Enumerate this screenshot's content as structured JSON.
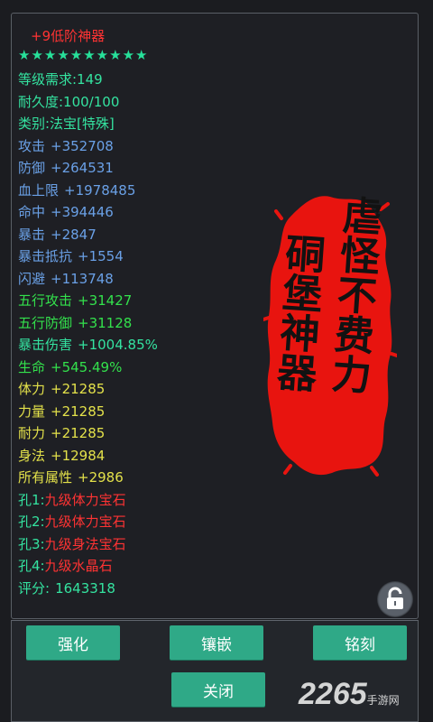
{
  "item": {
    "name": "+9低阶神器",
    "stars": "★★★★★★★★★★",
    "stats": [
      {
        "label": "等级需求:149",
        "value": "",
        "color": "green"
      },
      {
        "label": "耐久度:100/100",
        "value": "",
        "color": "green"
      },
      {
        "label": "类别:法宝[特殊]",
        "value": "",
        "color": "green"
      },
      {
        "label": "攻击",
        "value": "+352708",
        "color": "blue"
      },
      {
        "label": "防御",
        "value": "+264531",
        "color": "blue"
      },
      {
        "label": "血上限",
        "value": "+1978485",
        "color": "blue"
      },
      {
        "label": "命中",
        "value": "+394446",
        "color": "blue"
      },
      {
        "label": "暴击",
        "value": "+2847",
        "color": "blue"
      },
      {
        "label": "暴击抵抗",
        "value": "+1554",
        "color": "blue"
      },
      {
        "label": "闪避",
        "value": "+113748",
        "color": "blue"
      },
      {
        "label": "五行攻击",
        "value": "+31427",
        "color": "lime"
      },
      {
        "label": "五行防御",
        "value": "+31128",
        "color": "lime"
      },
      {
        "label": "暴击伤害",
        "value": "+1004.85%",
        "color": "green"
      },
      {
        "label": "生命",
        "value": "+545.49%",
        "color": "lime"
      },
      {
        "label": "体力",
        "value": "+21285",
        "color": "yellow"
      },
      {
        "label": "力量",
        "value": "+21285",
        "color": "yellow"
      },
      {
        "label": "耐力",
        "value": "+21285",
        "color": "yellow"
      },
      {
        "label": "身法",
        "value": "+12984",
        "color": "yellow"
      },
      {
        "label": "所有属性",
        "value": "+2986",
        "color": "yellow"
      }
    ],
    "holes": [
      {
        "label": "孔1:",
        "value": "九级体力宝石"
      },
      {
        "label": "孔2:",
        "value": "九级体力宝石"
      },
      {
        "label": "孔3:",
        "value": "九级身法宝石"
      },
      {
        "label": "孔4:",
        "value": "九级水晶石"
      }
    ],
    "score_label": "评分:",
    "score_value": "1643318",
    "seal_text_right": "虐怪不费力",
    "seal_text_left": "硐堡神器"
  },
  "buttons": {
    "enhance": "强化",
    "inlay": "镶嵌",
    "engrave": "铭刻",
    "close": "关闭"
  },
  "watermark": {
    "text": "2265",
    "sub": "手游网"
  },
  "colors": {
    "green": "#34e3a0",
    "blue": "#6aa0e6",
    "lime": "#33e14c",
    "yellow": "#e3e14a",
    "red": "#ff3333",
    "button": "#2fa987",
    "seal": "#e8140f"
  },
  "icons": {
    "lock": "unlock-icon"
  }
}
